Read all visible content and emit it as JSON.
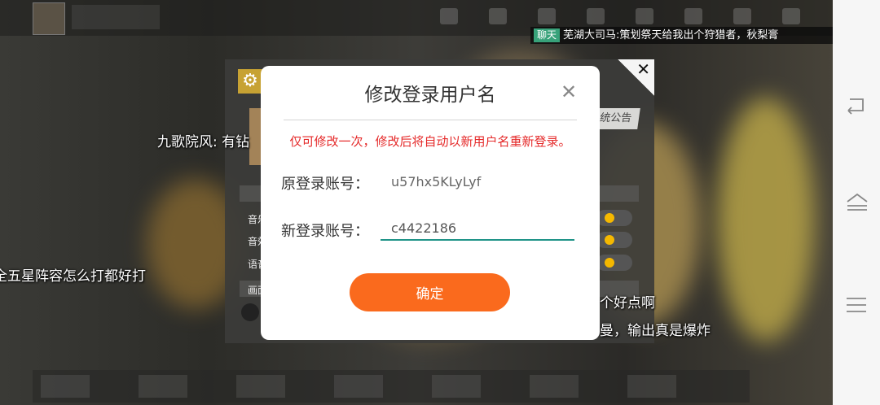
{
  "chat_banner": {
    "tag": "聊天",
    "message": "芜湖大司马:策划祭天给我出个狩猎者，秋梨膏"
  },
  "danmaku": [
    "九歌院风: 有钻",
    "全五星阵容怎么打都好打",
    "个好点啊",
    "曼，输出真是爆炸"
  ],
  "settings_panel": {
    "notice_button": "统公告",
    "labels": [
      "音乐",
      "音效",
      "语音",
      "画面"
    ]
  },
  "dialog": {
    "title": "修改登录用户名",
    "warning": "仅可修改一次，修改后将自动以新用户名重新登录。",
    "old_label": "原登录账号：",
    "old_value": "u57hx5KLyLyf",
    "new_label": "新登录账号：",
    "new_value": "c4422186",
    "confirm": "确定",
    "close_glyph": "✕"
  },
  "panel_close_glyph": "✕",
  "navbar": {
    "icons": [
      "back-icon",
      "home-icon",
      "menu-icon"
    ]
  },
  "colors": {
    "confirm_button": "#fa6a1d",
    "warning_text": "#e52a2a",
    "input_underline": "#1f9488",
    "chat_tag": "#38a27a"
  }
}
